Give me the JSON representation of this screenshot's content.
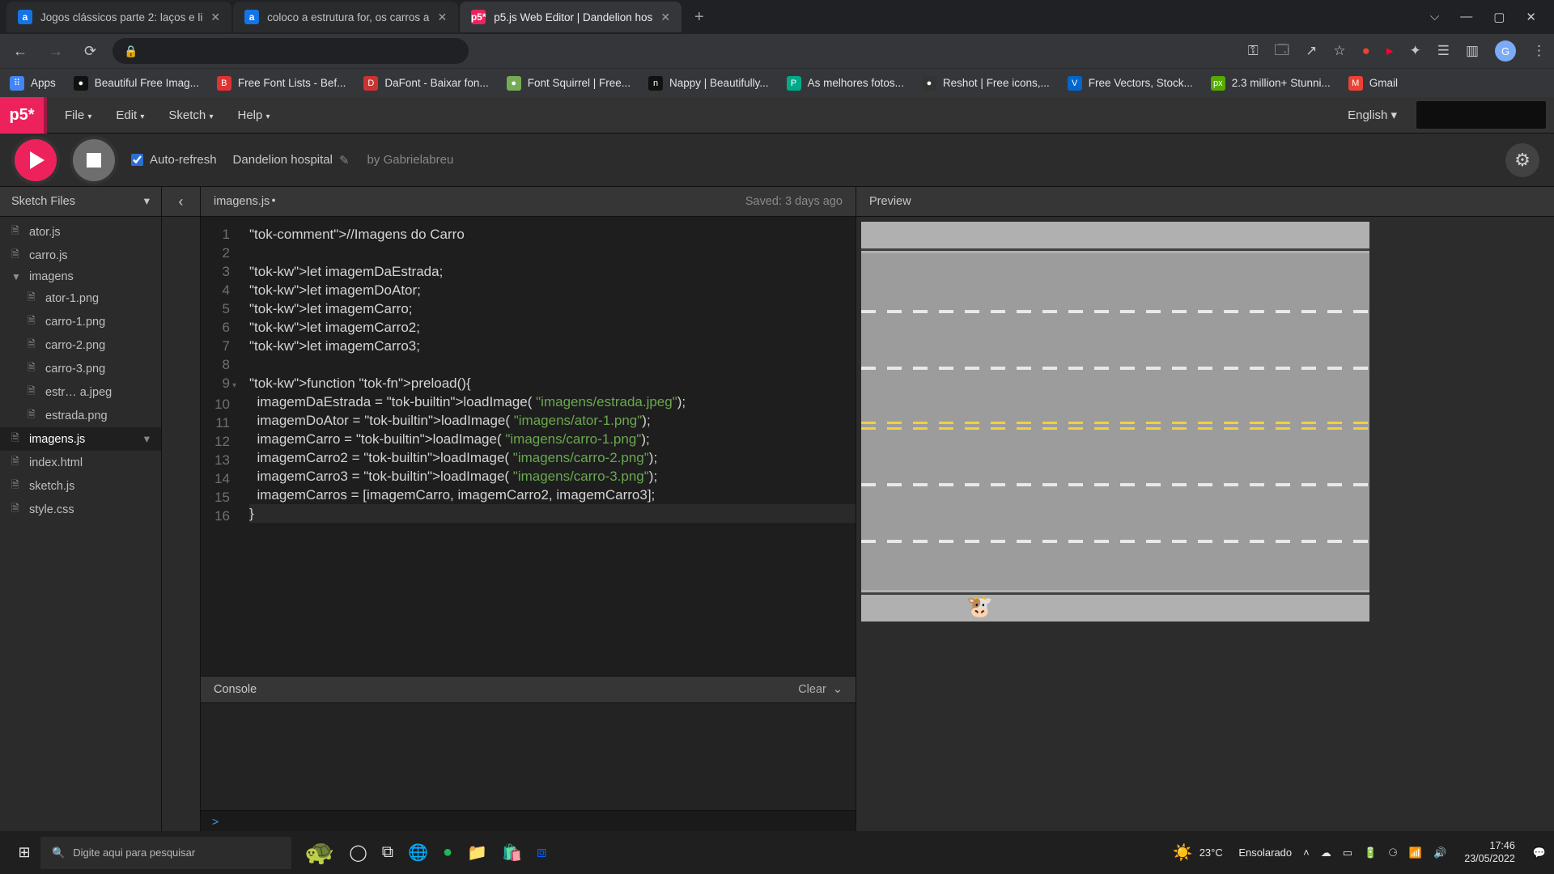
{
  "browser": {
    "tabs": [
      {
        "favicon": "a",
        "title": "Jogos clássicos parte 2: laços e li"
      },
      {
        "favicon": "a",
        "title": "coloco a estrutura for, os carros a"
      },
      {
        "favicon": "p5*",
        "title": "p5.js Web Editor | Dandelion hos"
      }
    ],
    "bookmarks": [
      {
        "icon": "⠿",
        "label": "Apps",
        "color": "#4285f4"
      },
      {
        "icon": "●",
        "label": "Beautiful Free Imag...",
        "color": "#111"
      },
      {
        "icon": "B",
        "label": "Free Font Lists - Bef...",
        "color": "#d33"
      },
      {
        "icon": "D",
        "label": "DaFont - Baixar fon...",
        "color": "#c33"
      },
      {
        "icon": "●",
        "label": "Font Squirrel | Free...",
        "color": "#7a5"
      },
      {
        "icon": "n",
        "label": "Nappy | Beautifully...",
        "color": "#111"
      },
      {
        "icon": "P",
        "label": "As melhores fotos...",
        "color": "#0a8"
      },
      {
        "icon": "●",
        "label": "Reshot | Free icons,...",
        "color": "#333"
      },
      {
        "icon": "V",
        "label": "Free Vectors, Stock...",
        "color": "#06c"
      },
      {
        "icon": "px",
        "label": "2.3 million+ Stunni...",
        "color": "#5a0"
      },
      {
        "icon": "M",
        "label": "Gmail",
        "color": "#ea4335"
      }
    ]
  },
  "p5": {
    "logo": "p5*",
    "menu": [
      "File",
      "Edit",
      "Sketch",
      "Help"
    ],
    "language": "English",
    "auto_refresh_label": "Auto-refresh",
    "sketch_name": "Dandelion hospital",
    "by_label": "by",
    "author": "Gabrielabreu",
    "sidebar_title": "Sketch Files",
    "files": [
      {
        "name": "ator.js",
        "type": "file"
      },
      {
        "name": "carro.js",
        "type": "file"
      },
      {
        "name": "imagens",
        "type": "folder_open"
      },
      {
        "name": "ator-1.png",
        "type": "file",
        "nested": true
      },
      {
        "name": "carro-1.png",
        "type": "file",
        "nested": true
      },
      {
        "name": "carro-2.png",
        "type": "file",
        "nested": true
      },
      {
        "name": "carro-3.png",
        "type": "file",
        "nested": true
      },
      {
        "name": "estr… a.jpeg",
        "type": "file",
        "nested": true
      },
      {
        "name": "estrada.png",
        "type": "file",
        "nested": true
      },
      {
        "name": "imagens.js",
        "type": "file",
        "active": true
      },
      {
        "name": "index.html",
        "type": "file"
      },
      {
        "name": "sketch.js",
        "type": "file"
      },
      {
        "name": "style.css",
        "type": "file"
      }
    ],
    "open_file": "imagens.js",
    "saved": "Saved: 3 days ago",
    "preview_title": "Preview",
    "console_title": "Console",
    "console_clear": "Clear",
    "console_prompt": ">"
  },
  "code": {
    "lines": [
      "//Imagens do Carro",
      "",
      "let imagemDaEstrada;",
      "let imagemDoAtor;",
      "let imagemCarro;",
      "let imagemCarro2;",
      "let imagemCarro3;",
      "",
      "function preload(){",
      "  imagemDaEstrada = loadImage( \"imagens/estrada.jpeg\");",
      "  imagemDoAtor = loadImage( \"imagens/ator-1.png\");",
      "  imagemCarro = loadImage( \"imagens/carro-1.png\");",
      "  imagemCarro2 = loadImage( \"imagens/carro-2.png\");",
      "  imagemCarro3 = loadImage( \"imagens/carro-3.png\");",
      "  imagemCarros = [imagemCarro, imagemCarro2, imagemCarro3];",
      "}"
    ]
  },
  "taskbar": {
    "search_placeholder": "Digite aqui para pesquisar",
    "weather_temp": "23°C",
    "weather_cond": "Ensolarado",
    "time": "17:46",
    "date": "23/05/2022"
  }
}
